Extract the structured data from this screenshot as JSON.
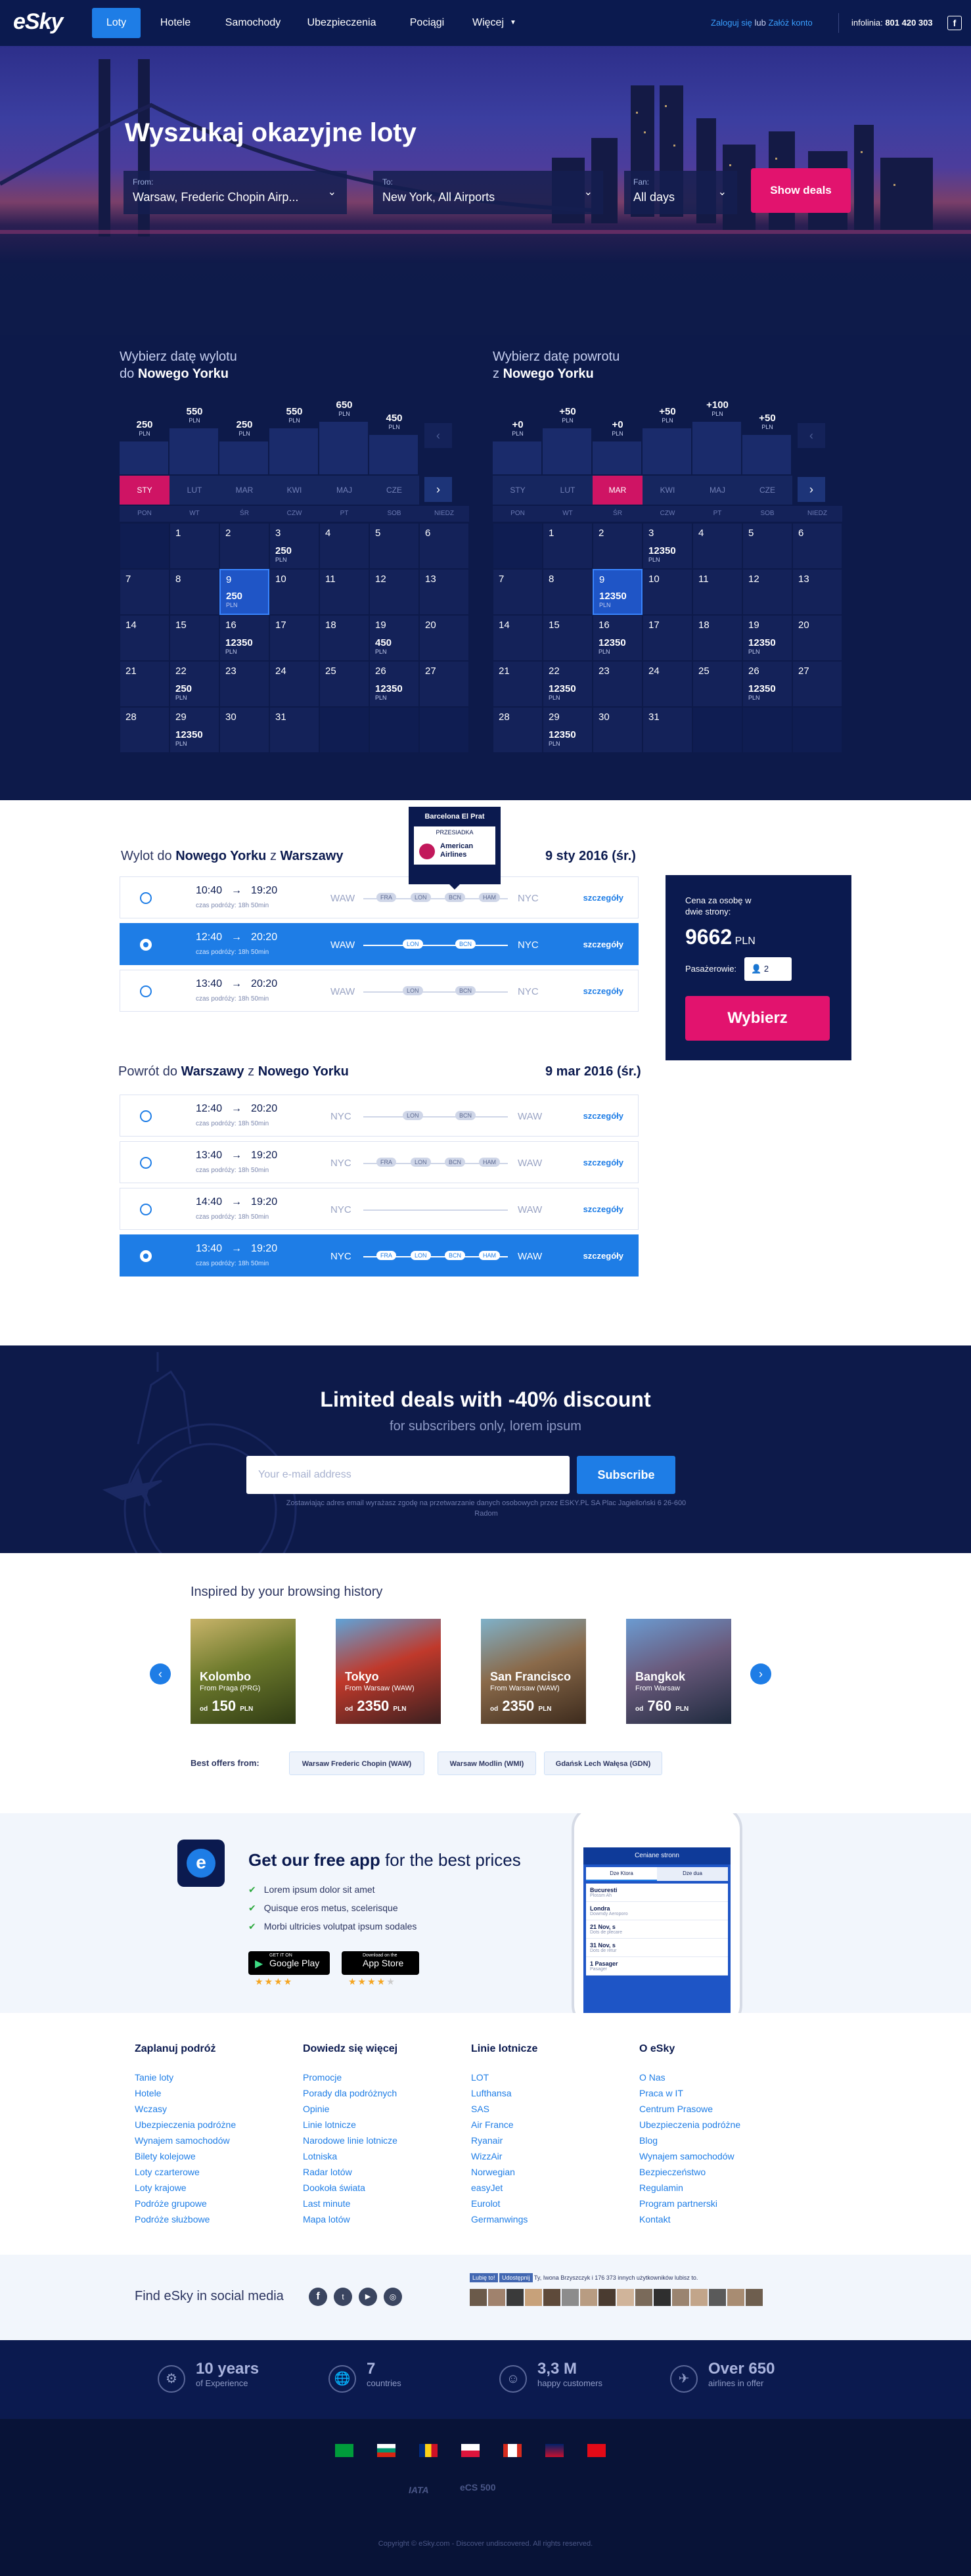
{
  "header": {
    "logo": "eSky",
    "nav": [
      "Loty",
      "Hotele",
      "Samochody",
      "Ubezpieczenia",
      "Pociągi",
      "Więcej"
    ],
    "login": "Zaloguj się",
    "or": "lub",
    "register": "Załóż konto",
    "infoline_label": "infolinia:",
    "infoline": "801 420 303"
  },
  "hero": {
    "title": "Wyszukaj okazyjne loty",
    "from_label": "From:",
    "from_value": "Warsaw, Frederic Chopin Airp...",
    "to_label": "To:",
    "to_value": "New York, All Airports",
    "when_label": "Fan:",
    "when_value": "All days",
    "button": "Show deals"
  },
  "calendar_out": {
    "heading": "Wybierz datę wylotu",
    "heading2": "do",
    "city": "Nowego Yorku",
    "months": [
      {
        "label": "STY",
        "price": "250"
      },
      {
        "label": "LUT",
        "price": "550"
      },
      {
        "label": "MAR",
        "price": "250"
      },
      {
        "label": "KWI",
        "price": "550"
      },
      {
        "label": "MAJ",
        "price": "650"
      },
      {
        "label": "CZE",
        "price": "450"
      }
    ],
    "currency": "PLN",
    "days": [
      "PON",
      "WT",
      "ŚR",
      "CZW",
      "PT",
      "SOB",
      "NIEDZ"
    ]
  },
  "calendar_ret": {
    "heading": "Wybierz datę powrotu",
    "heading2": "z",
    "city": "Nowego Yorku",
    "months": [
      {
        "label": "STY",
        "price": "+0"
      },
      {
        "label": "LUT",
        "price": "+50"
      },
      {
        "label": "MAR",
        "price": "+0"
      },
      {
        "label": "KWI",
        "price": "+50"
      },
      {
        "label": "MAJ",
        "price": "+100"
      },
      {
        "label": "CZE",
        "price": "+50"
      }
    ]
  },
  "outbound": {
    "title_a": "Wylot do",
    "city_a": "Nowego Yorku",
    "title_b": "z",
    "city_b": "Warszawy",
    "date": "9 sty 2016 (śr.)",
    "flights": [
      {
        "dep": "10:40",
        "arr": "19:20",
        "time": "czas podróży: 18h 50min",
        "stops": [
          "FRA",
          "LON",
          "BCN",
          "HAM"
        ]
      },
      {
        "dep": "12:40",
        "arr": "20:20",
        "time": "czas podróży: 18h 50min",
        "stops": [
          "LON",
          "BCN"
        ]
      },
      {
        "dep": "13:40",
        "arr": "20:20",
        "time": "czas podróży: 18h 50min",
        "stops": [
          "LON",
          "BCN"
        ]
      }
    ],
    "from": "WAW",
    "to": "NYC",
    "details": "szczegóły"
  },
  "tooltip": {
    "city": "Barcelona El Prat",
    "label": "PRZESIADKA",
    "airline": "American Airlines"
  },
  "pricebox": {
    "label": "Cena za osobę w dwie strony:",
    "price": "9662",
    "currency": "PLN",
    "passengers_label": "Pasażerowie:",
    "passengers": "2",
    "button": "Wybierz"
  },
  "inbound": {
    "title_a": "Powrót do",
    "city_a": "Warszawy",
    "title_b": "z",
    "city_b": "Nowego Yorku",
    "date": "9 mar 2016 (śr.)",
    "flights": [
      {
        "dep": "12:40",
        "arr": "20:20",
        "time": "czas podróży: 18h 50min",
        "stops": [
          "LON",
          "BCN"
        ]
      },
      {
        "dep": "13:40",
        "arr": "19:20",
        "time": "czas podróży: 18h 50min",
        "stops": [
          "FRA",
          "LON",
          "BCN",
          "HAM"
        ]
      },
      {
        "dep": "14:40",
        "arr": "19:20",
        "time": "czas podróży: 18h 50min",
        "stops": []
      },
      {
        "dep": "13:40",
        "arr": "19:20",
        "time": "czas podróży: 18h 50min",
        "stops": [
          "FRA",
          "LON",
          "BCN",
          "HAM"
        ]
      }
    ],
    "from": "NYC",
    "to": "WAW",
    "details": "szczegóły"
  },
  "newsletter": {
    "title": "Limited deals with -40% discount",
    "subtitle": "for subscribers only, lorem ipsum",
    "placeholder": "Your e-mail address",
    "button": "Subscribe",
    "legal": "Zostawiając adres email wyrażasz zgodę na przetwarzanie danych osobowych przez ESKY.PL SA Plac Jagielloński 6 26-600 Radom"
  },
  "inspired": {
    "title": "Inspired by your browsing history",
    "cards": [
      {
        "city": "Kolombo",
        "from": "From Praga (PRG)",
        "price": "150"
      },
      {
        "city": "Tokyo",
        "from": "From Warsaw (WAW)",
        "price": "2350"
      },
      {
        "city": "San Francisco",
        "from": "From Warsaw (WAW)",
        "price": "2350"
      },
      {
        "city": "Bangkok",
        "from": "From Warsaw",
        "price": "760"
      }
    ],
    "od": "od",
    "currency": "PLN",
    "best_label": "Best offers from:",
    "best": [
      "Warsaw Frederic Chopin (WAW)",
      "Warsaw Modlin (WMI)",
      "Gdańsk Lech Wałęsa (GDN)"
    ]
  },
  "app": {
    "title_a": "Get our free app",
    "title_b": "for the best prices",
    "bullets": [
      "Lorem ipsum dolor sit amet",
      "Quisque eros metus, scelerisque",
      "Morbi ultricies volutpat ipsum sodales"
    ],
    "gp": "Google Play",
    "as": "App Store",
    "gp_small": "GET IT ON",
    "as_small": "Download on the",
    "phone_title": "Ceniane stronn",
    "phone_tab1": "Dze Ktora",
    "phone_tab2": "Dze dua",
    "phone_rows": [
      {
        "t": "Bucuresti",
        "s": "Plossm Ah"
      },
      {
        "t": "Londra",
        "s": "Dowmdy Aeroporo"
      },
      {
        "t": "21 Nov, s",
        "s": "Dots de plecare"
      },
      {
        "t": "31 Nov, s",
        "s": "Dots de retur"
      },
      {
        "t": "1 Pasager",
        "s": "Pasager"
      }
    ]
  },
  "footer_links": [
    {
      "title": "Zaplanuj podróż",
      "items": [
        "Tanie loty",
        "Hotele",
        "Wczasy",
        "Ubezpieczenia podróżne",
        "Wynajem samochodów",
        "Bilety kolejowe",
        "Loty czarterowe",
        "Loty krajowe",
        "Podróże grupowe",
        "Podróże służbowe"
      ]
    },
    {
      "title": "Dowiedz się więcej",
      "items": [
        "Promocje",
        "Porady dla podróżnych",
        "Opinie",
        "Linie lotnicze",
        "Narodowe linie lotnicze",
        "Lotniska",
        "Radar lotów",
        "Dookoła świata",
        "Last minute",
        "Mapa lotów"
      ]
    },
    {
      "title": "Linie lotnicze",
      "items": [
        "LOT",
        "Lufthansa",
        "SAS",
        "Air France",
        "Ryanair",
        "WizzAir",
        "Norwegian",
        "easyJet",
        "Eurolot",
        "Germanwings"
      ]
    },
    {
      "title": "O eSky",
      "items": [
        "O Nas",
        "Praca w IT",
        "Centrum Prasowe",
        "Ubezpieczenia podróżne",
        "Blog",
        "Wynajem samochodów",
        "Bezpieczeństwo",
        "Regulamin",
        "Program partnerski",
        "Kontakt"
      ]
    }
  ],
  "social": {
    "label": "Find eSky in social media",
    "fb_like": "Lubię to!",
    "fb_share": "Udostępnij",
    "fb_text": "Ty, Iwona Brzyszczyk i 176 373 innych użytkowników lubisz to."
  },
  "stats": [
    {
      "v": "10 years",
      "l": "of Experience"
    },
    {
      "v": "7",
      "l": "countries"
    },
    {
      "v": "3,3 M",
      "l": "happy customers"
    },
    {
      "v": "Over 650",
      "l": "airlines in offer"
    }
  ],
  "badges": {
    "iata": "IATA",
    "trust": "eCS 500"
  },
  "copyright": "Copyright © eSky.com - Discover undiscovered. All rights reserved.",
  "colors": {
    "navy": "#0b1a4f",
    "blue": "#1e7de6",
    "pink": "#e2136e"
  }
}
